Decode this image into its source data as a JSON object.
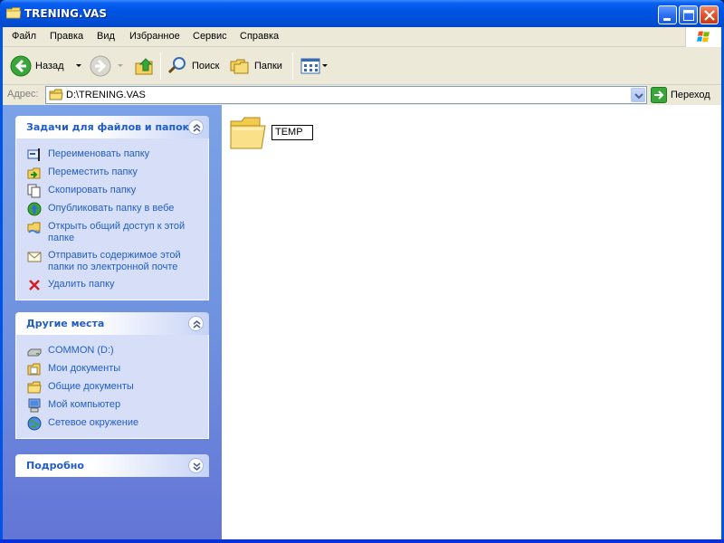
{
  "window": {
    "title": "TRENING.VAS"
  },
  "menu": {
    "items": [
      {
        "label": "Файл"
      },
      {
        "label": "Правка"
      },
      {
        "label": "Вид"
      },
      {
        "label": "Избранное"
      },
      {
        "label": "Сервис"
      },
      {
        "label": "Справка"
      }
    ]
  },
  "toolbar": {
    "back_label": "Назад",
    "search_label": "Поиск",
    "folders_label": "Папки"
  },
  "address": {
    "label": "Адрес:",
    "value": "D:\\TRENING.VAS",
    "go_label": "Переход"
  },
  "taskpane": {
    "file_tasks": {
      "title": "Задачи для файлов и папок",
      "items": [
        {
          "label": "Переименовать папку",
          "icon": "rename-icon"
        },
        {
          "label": "Переместить папку",
          "icon": "move-icon"
        },
        {
          "label": "Скопировать папку",
          "icon": "copy-icon"
        },
        {
          "label": "Опубликовать папку в вебе",
          "icon": "publish-web-icon"
        },
        {
          "label": "Открыть общий доступ к этой папке",
          "icon": "share-icon"
        },
        {
          "label": "Отправить содержимое этой папки по электронной почте",
          "icon": "email-icon"
        },
        {
          "label": "Удалить папку",
          "icon": "delete-icon"
        }
      ]
    },
    "other_places": {
      "title": "Другие места",
      "items": [
        {
          "label": "COMMON (D:)",
          "icon": "drive-icon"
        },
        {
          "label": "Мои документы",
          "icon": "my-documents-icon"
        },
        {
          "label": "Общие документы",
          "icon": "shared-documents-icon"
        },
        {
          "label": "Мой компьютер",
          "icon": "my-computer-icon"
        },
        {
          "label": "Сетевое окружение",
          "icon": "network-icon"
        }
      ]
    },
    "details": {
      "title": "Подробно"
    }
  },
  "content": {
    "folder_name": "TEMP"
  },
  "colors": {
    "title_blue": "#0054e3",
    "link_blue": "#215dc6",
    "pane_blue": "#6f92e0",
    "folder_yellow": "#f5d263"
  }
}
